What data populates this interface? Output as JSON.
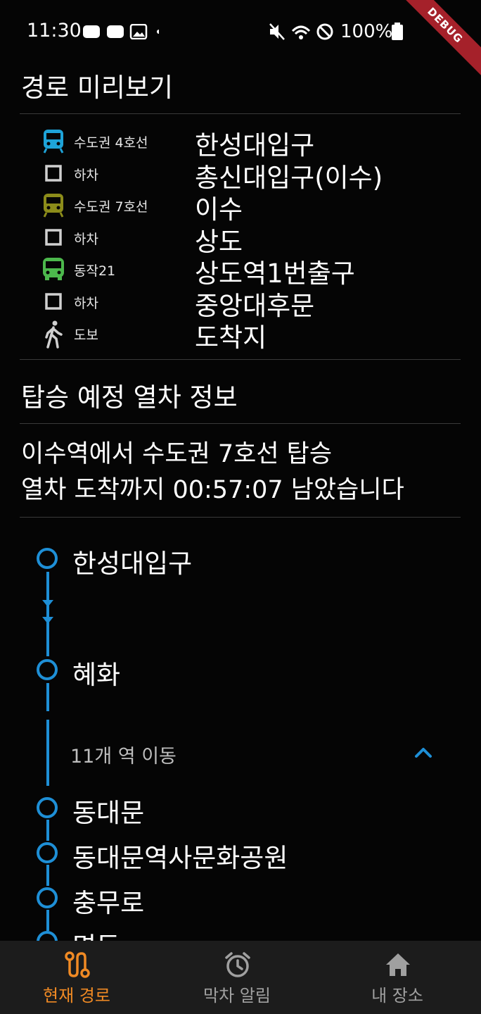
{
  "status_bar": {
    "time": "11:30",
    "battery": "100%",
    "debug_label": "DEBUG"
  },
  "preview": {
    "title": "경로 미리보기",
    "steps": [
      {
        "icon": "subway-icon",
        "color": "#1ea3d8",
        "tag": "수도권 4호선",
        "station": "한성대입구"
      },
      {
        "icon": "square-outline-icon",
        "color": "#d0d0d0",
        "tag": "하차",
        "station": "총신대입구(이수)"
      },
      {
        "icon": "subway-icon",
        "color": "#8c8c1a",
        "tag": "수도권 7호선",
        "station": "이수"
      },
      {
        "icon": "square-outline-icon",
        "color": "#d0d0d0",
        "tag": "하차",
        "station": "상도"
      },
      {
        "icon": "bus-icon",
        "color": "#4cb84c",
        "tag": "동작21",
        "station": "상도역1번출구"
      },
      {
        "icon": "square-outline-icon",
        "color": "#d0d0d0",
        "tag": "하차",
        "station": "중앙대후문"
      },
      {
        "icon": "walk-icon",
        "color": "#d0d0d0",
        "tag": "도보",
        "station": "도착지"
      }
    ]
  },
  "train_info": {
    "title": "탑승 예정 열차 정보",
    "line1": "이수역에서 수도권 7호선 탑승",
    "line2": "열차 도착까지 00:57:07 남았습니다"
  },
  "timeline": {
    "accent": "#1e8fd6",
    "stations": [
      "한성대입구",
      "혜화",
      "동대문",
      "동대문역사문화공원",
      "충무로",
      "명동"
    ],
    "moved_count": "11개 역 이동"
  },
  "bottom_nav": {
    "active_color": "#f08a24",
    "inactive_color": "#a0a0a0",
    "items": [
      {
        "label": "현재 경로",
        "icon": "route-icon",
        "active": true
      },
      {
        "label": "막차 알림",
        "icon": "alarm-clock-icon",
        "active": false
      },
      {
        "label": "내 장소",
        "icon": "home-icon",
        "active": false
      }
    ]
  }
}
